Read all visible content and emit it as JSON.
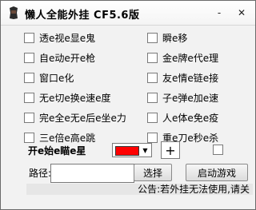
{
  "window": {
    "title": "懒人全能外挂 CF5.6版"
  },
  "controls": {
    "minimize": "-",
    "close": "✕"
  },
  "left_options": [
    "透e视e显e鬼",
    "自e动e开e枪",
    "窗口e化",
    "无e切e换e速e度",
    "完e全e无e后e坐e力",
    "三e倍e高e跳"
  ],
  "right_options": [
    "瞬e移",
    "金e牌e代e理",
    "友e情e链e接",
    "子e弹e加e速",
    "人e体e免e疫",
    "重e刀e秒e杀"
  ],
  "star": {
    "label": "开e始e瞄e星",
    "color": "#ff0000"
  },
  "path": {
    "label": "路径:",
    "value": ""
  },
  "buttons": {
    "select": "选择",
    "start": "启动游戏"
  },
  "notice": "公告:若外挂无法使用,请关"
}
